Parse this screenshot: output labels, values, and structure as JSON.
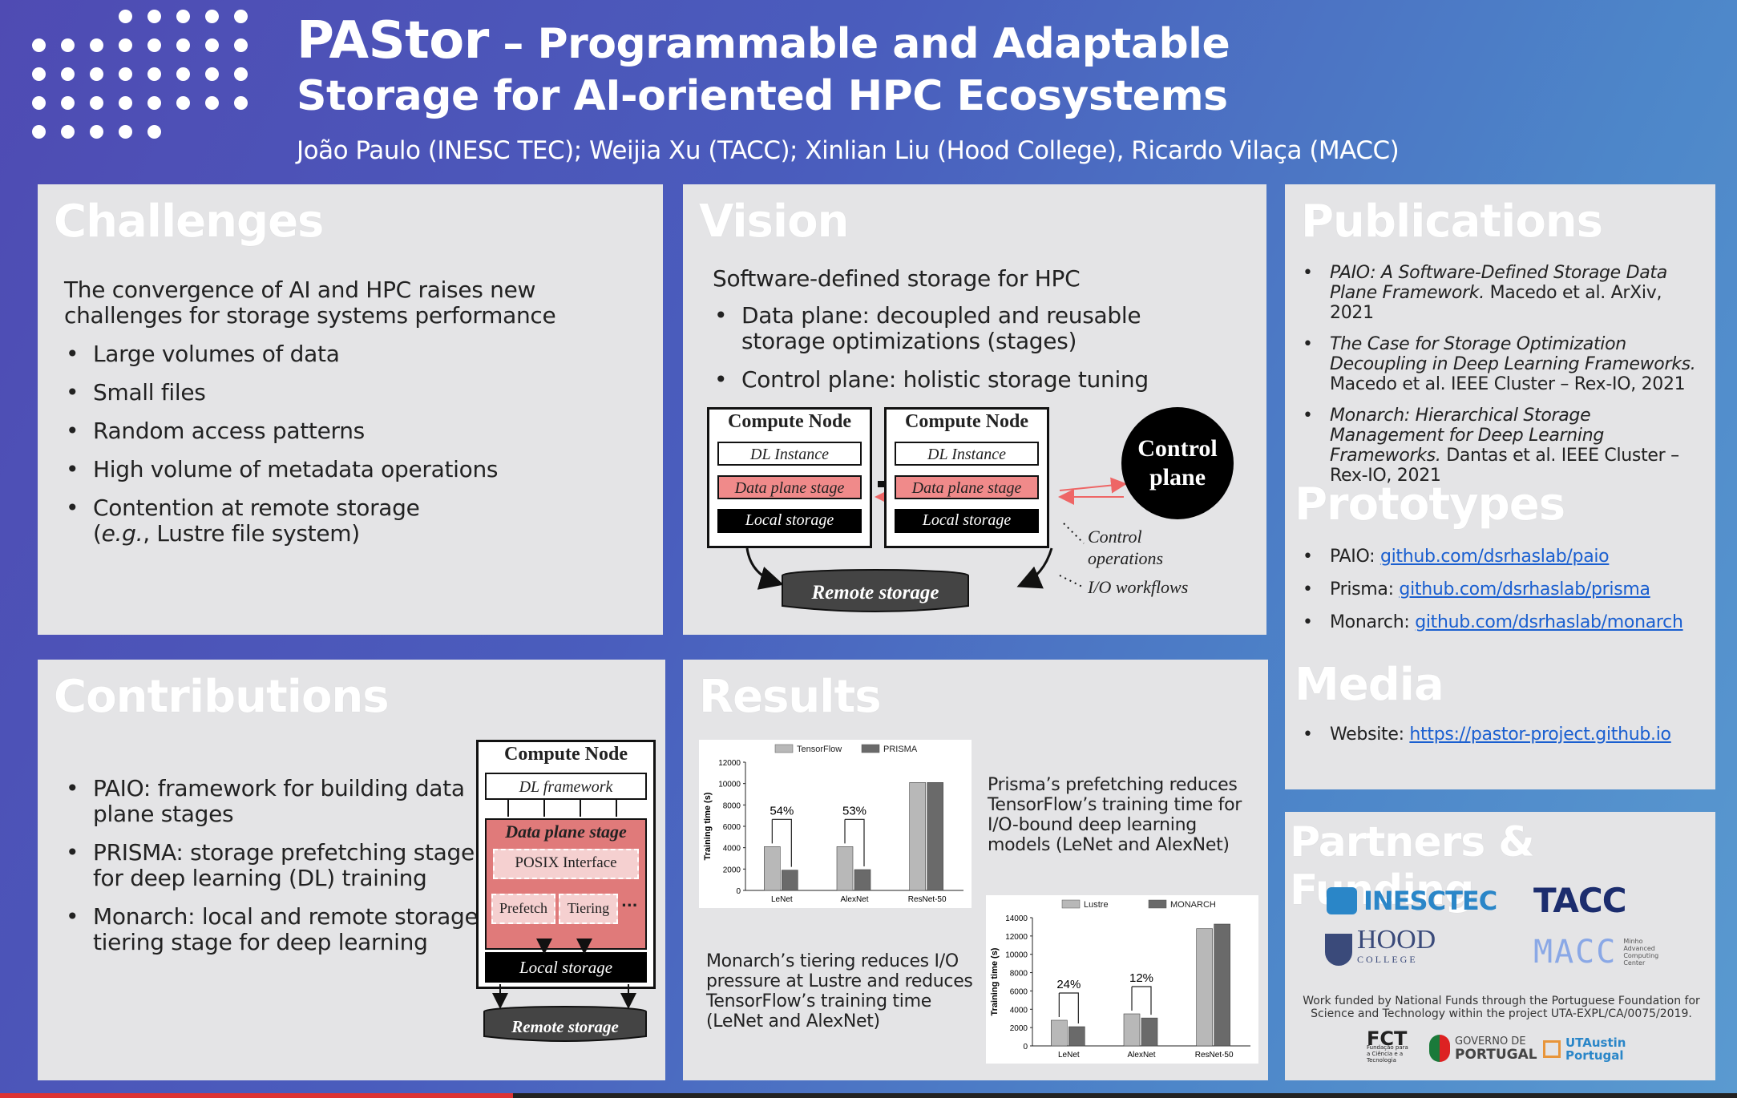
{
  "header": {
    "title_lead": "PAStor",
    "title_rest": " – Programmable and Adaptable",
    "title_line2": "Storage for AI-oriented HPC Ecosystems",
    "authors": "João Paulo (INESC TEC); Weijia Xu (TACC); Xinlian Liu (Hood College), Ricardo Vilaça (MACC)"
  },
  "challenges": {
    "heading": "Challenges",
    "intro": "The convergence of AI and HPC raises new challenges for storage systems performance",
    "items": [
      "Large volumes of data",
      "Small files",
      "Random access patterns",
      "High volume of metadata operations",
      "Contention at remote storage"
    ],
    "last_item_sub_eg": "e.g.",
    "last_item_sub_rest": ", Lustre file system)"
  },
  "vision": {
    "heading": "Vision",
    "intro": "Software-defined storage for HPC",
    "items": [
      "Data plane: decoupled and reusable storage optimizations (stages)",
      "Control plane: holistic storage tuning"
    ],
    "diagram": {
      "compute_node": "Compute Node",
      "dl_instance": "DL Instance",
      "data_plane_stage": "Data plane stage",
      "local_storage": "Local storage",
      "control_plane_1": "Control",
      "control_plane_2": "plane",
      "control_ops_1": "Control",
      "control_ops_2": "operations",
      "io_workflows": "I/O workflows",
      "remote_storage": "Remote storage"
    }
  },
  "publications": {
    "heading": "Publications",
    "items": [
      {
        "title": "PAIO: A Software-Defined Storage Data Plane Framework.",
        "rest": " Macedo et al. ArXiv, 2021"
      },
      {
        "title": "The Case for Storage Optimization Decoupling in Deep Learning Frameworks.",
        "rest": " Macedo et al. IEEE Cluster – Rex-IO, 2021"
      },
      {
        "title": "Monarch: Hierarchical Storage Management for Deep Learning Frameworks.",
        "rest": " Dantas et al. IEEE Cluster – Rex-IO, 2021"
      }
    ]
  },
  "prototypes": {
    "heading": "Prototypes",
    "items": [
      {
        "label": "PAIO: ",
        "link": "github.com/dsrhaslab/paio"
      },
      {
        "label": "Prisma: ",
        "link": "github.com/dsrhaslab/prisma"
      },
      {
        "label": "Monarch: ",
        "link": "github.com/dsrhaslab/monarch"
      }
    ]
  },
  "media": {
    "heading": "Media",
    "label": "Website: ",
    "link": "https://pastor-project.github.io"
  },
  "contributions": {
    "heading": "Contributions",
    "items": [
      "PAIO: framework for building data plane stages",
      "PRISMA: storage prefetching stage for deep learning (DL) training",
      "Monarch: local and remote storage tiering stage for deep learning"
    ],
    "diagram": {
      "compute_node": "Compute Node",
      "dl_framework": "DL framework",
      "data_plane_stage": "Data plane stage",
      "posix": "POSIX Interface",
      "prefetch": "Prefetch",
      "tiering": "Tiering",
      "dots": "...",
      "local_storage": "Local storage",
      "remote_storage": "Remote storage"
    }
  },
  "results": {
    "heading": "Results",
    "caption_prisma": "Prisma’s prefetching reduces TensorFlow’s training time for I/O-bound deep learning models (LeNet and AlexNet)",
    "caption_monarch": "Monarch’s tiering reduces I/O pressure at Lustre and reduces TensorFlow’s training time (LeNet and AlexNet)"
  },
  "partners": {
    "heading": "Partners & Funding",
    "logos": [
      "INESCTEC",
      "TACC",
      "HOOD",
      "COLLEGE",
      "MACC",
      "FCT",
      "GOVERNO DE",
      "PORTUGAL",
      "UTAustin",
      "Portugal"
    ],
    "macc_sub": "Minho Advanced Computing Center",
    "fct_sub": "Fundação para a Ciência e a Tecnologia",
    "funding": "Work funded by National Funds through the Portuguese Foundation for Science and Technology within the project UTA-EXPL/CA/0075/2019."
  },
  "chart_data": [
    {
      "type": "bar",
      "categories": [
        "LeNet",
        "AlexNet",
        "ResNet-50"
      ],
      "series": [
        {
          "name": "TensorFlow",
          "values": [
            4100,
            4100,
            10100
          ]
        },
        {
          "name": "PRISMA",
          "values": [
            1900,
            1950,
            10100
          ]
        }
      ],
      "ylabel": "Training time (s)",
      "ylim": [
        0,
        12000
      ],
      "yticks": [
        0,
        2000,
        4000,
        6000,
        8000,
        10000,
        12000
      ],
      "annotations": [
        "54%",
        "53%"
      ],
      "colors": [
        "#b8b8b8",
        "#6a6a6a"
      ]
    },
    {
      "type": "bar",
      "categories": [
        "LeNet",
        "AlexNet",
        "ResNet-50"
      ],
      "series": [
        {
          "name": "Lustre",
          "values": [
            2800,
            3500,
            12800
          ]
        },
        {
          "name": "MONARCH",
          "values": [
            2100,
            3050,
            13300
          ]
        }
      ],
      "ylabel": "Training time (s)",
      "ylim": [
        0,
        14000
      ],
      "yticks": [
        0,
        2000,
        4000,
        6000,
        8000,
        10000,
        12000,
        14000
      ],
      "annotations": [
        "24%",
        "12%"
      ],
      "colors": [
        "#b8b8b8",
        "#6a6a6a"
      ]
    }
  ]
}
